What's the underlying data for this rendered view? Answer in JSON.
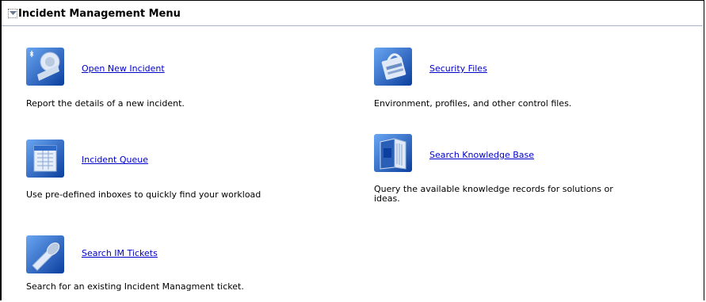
{
  "header": {
    "title": "Incident Management Menu",
    "collapse_icon": "collapse-arrow-icon"
  },
  "items": [
    {
      "label": "Open New Incident",
      "description": "Report the details of  a new incident.",
      "icon": "alarm-bell-icon"
    },
    {
      "label": "Security Files",
      "description": "Environment, profiles, and other control files.",
      "icon": "security-lock-icon"
    },
    {
      "label": "Incident Queue",
      "description": "Use pre-defined inboxes to quickly find your workload",
      "icon": "queue-spreadsheet-icon"
    },
    {
      "label": "Search Knowledge Base",
      "description_line1": "Query the available knowledge records for solutions or",
      "description_line2": "ideas.",
      "icon": "knowledge-book-icon"
    },
    {
      "label": "Search IM Tickets",
      "description": "Search for an existing Incident Managment ticket.",
      "icon": "flashlight-search-icon"
    }
  ],
  "colors": {
    "link": "#0000cc",
    "icon_blue": "#1e5fc8"
  }
}
